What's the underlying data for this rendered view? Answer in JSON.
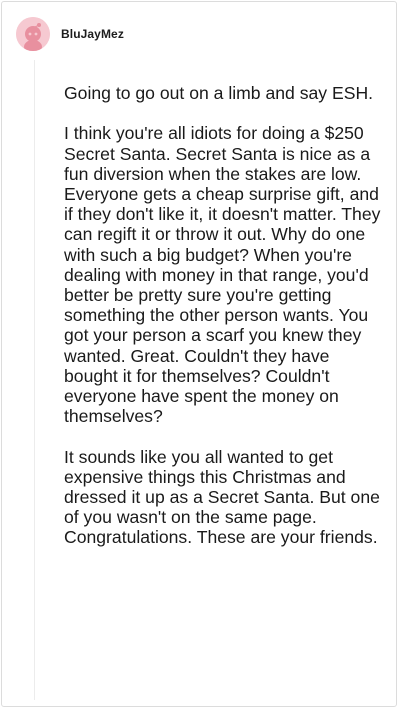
{
  "comment": {
    "username": "BluJayMez",
    "avatar_icon": "snoo-avatar-icon",
    "avatar_color": "#f6c9d1",
    "paragraphs": [
      "Going to go out on a limb and say ESH.",
      "I think you're all idiots for doing a $250 Secret Santa. Secret Santa is nice as a fun diversion when the stakes are low. Everyone gets a cheap surprise gift, and if they don't like it, it doesn't matter. They can regift it or throw it out. Why do one with such a big budget? When you're dealing with money in that range, you'd better be pretty sure you're getting something the other person wants. You got your person a scarf you knew they wanted. Great. Couldn't they have bought it for themselves? Couldn't everyone have spent the money on themselves?",
      "It sounds like you all wanted to get expensive things this Christmas and dressed it up as a Secret Santa. But one of you wasn't on the same page. Congratulations. These are your friends."
    ]
  }
}
